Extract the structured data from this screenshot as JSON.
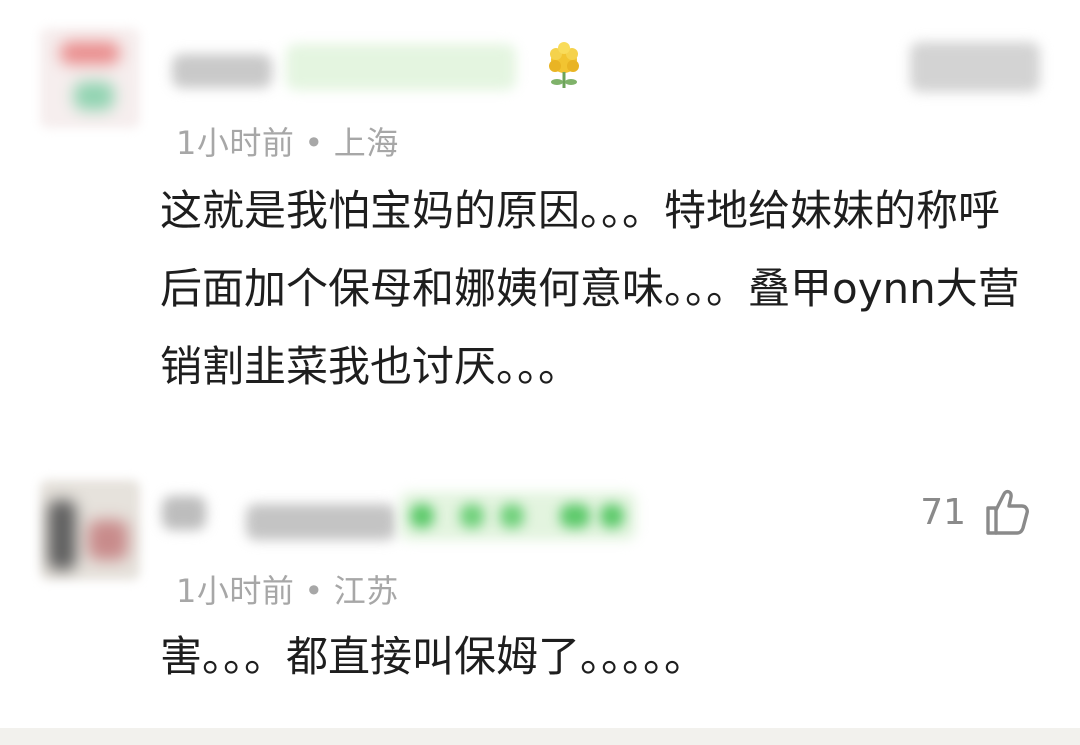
{
  "comments": [
    {
      "time": "1小时前",
      "separator": "•",
      "location": "上海",
      "text": "这就是我怕宝妈的原因。。。特地给妹妹的称呼后面加个保母和娜姨何意味。。。叠甲oynn大营销割韭菜我也讨厌。。。",
      "icons": [
        "blurred-avatar",
        "flower-badge-icon"
      ]
    },
    {
      "time": "1小时前",
      "separator": "•",
      "location": "江苏",
      "text": "害。。。都直接叫保姆了。。。。。",
      "likes": "71",
      "icons": [
        "blurred-avatar",
        "thumbs-up-icon"
      ]
    }
  ]
}
